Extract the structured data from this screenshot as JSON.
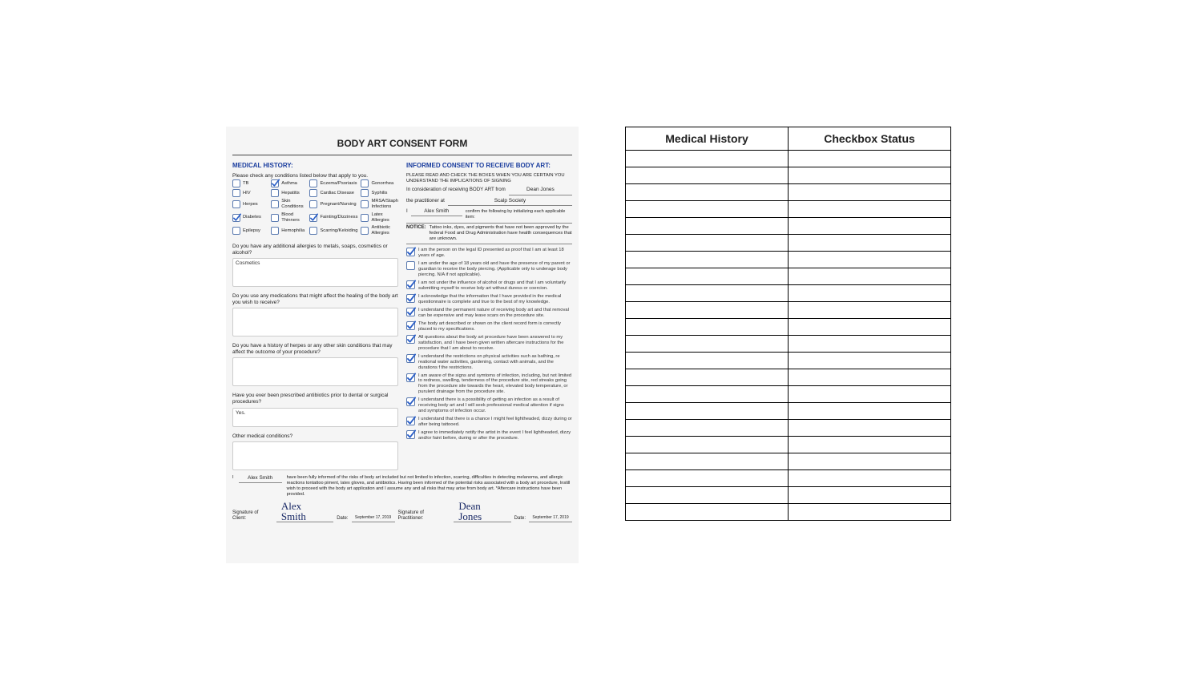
{
  "form": {
    "title": "BODY ART CONSENT FORM",
    "medical_history": {
      "heading": "MEDICAL HISTORY:",
      "instruction": "Please check any conditions listed below that apply to you.",
      "conditions": [
        {
          "label": "TB",
          "checked": false
        },
        {
          "label": "Asthma",
          "checked": true
        },
        {
          "label": "Eczema/Psoriasis",
          "checked": false
        },
        {
          "label": "Gonorrhea",
          "checked": false
        },
        {
          "label": "HIV",
          "checked": false
        },
        {
          "label": "Hepatitis",
          "checked": false
        },
        {
          "label": "Cardiac Disease",
          "checked": false
        },
        {
          "label": "Syphilis",
          "checked": false
        },
        {
          "label": "Herpes",
          "checked": false
        },
        {
          "label": "Skin Conditions",
          "checked": false
        },
        {
          "label": "Pregnant/Nursing",
          "checked": false
        },
        {
          "label": "MRSA/Staph Infections",
          "checked": false
        },
        {
          "label": "Diabetes",
          "checked": true
        },
        {
          "label": "Blood Thinners",
          "checked": false
        },
        {
          "label": "Fainting/Dizziness",
          "checked": true
        },
        {
          "label": "Latex Allergies",
          "checked": false
        },
        {
          "label": "Epilepsy",
          "checked": false
        },
        {
          "label": "Hemophilia",
          "checked": false
        },
        {
          "label": "Scarring/Keloiding",
          "checked": false
        },
        {
          "label": "Antibiotic Allergies",
          "checked": false
        }
      ],
      "q1": "Do you have any additional allergies to metals, soaps, cosmetics or alcohol?",
      "a1": "Cosmetics",
      "q2": "Do you use any medications that might affect the healing of the body art you wish to receive?",
      "a2": "",
      "q3": "Do you have a history of herpes or any other skin conditions that may affect the outcome of your procedure?",
      "a3": "",
      "q4": "Have you ever been prescribed antibiotics prior to dental or surgical procedures?",
      "a4": "Yes.",
      "q5": "Other medical conditions?",
      "a5": ""
    },
    "consent": {
      "heading": "INFORMED CONSENT TO RECEIVE BODY ART:",
      "intro": "PLEASE READ AND CHECK THE BOXES WHEN YOU ARE CERTAIN YOU UNDERSTAND THE IMPLICATIONS OF SIGNING",
      "line1_prefix": "In consideration of receiving BODY ART from",
      "from_name": "Dean Jones",
      "line2_prefix": "the practitioner at",
      "studio": "Scalp Society",
      "line3_prefix": "I",
      "client_name": "Alex Smith",
      "line3_suffix": "confirm the following by initializing each applicable item:",
      "notice_label": "NOTICE:",
      "notice_text": "Tattoo inks, dyes, and pigments that have not been approved by the federal Food and Drug Administration have health consequences that are unknown.",
      "items": [
        {
          "checked": true,
          "text": "I am the person on the legal ID presented as proof that I am at least 18 years of age."
        },
        {
          "checked": false,
          "text": "I am under the age of 18 years old and have the presence of my parent or guardian to receive the body piercing. (Applicable only to underage body piercing. N/A if not applicable)."
        },
        {
          "checked": true,
          "text": "I am not under the influence of alcohol or drugs and that I am voluntarily submitting myself to receive bdy art without duress or coercion."
        },
        {
          "checked": true,
          "text": "I acknowledge that the information that I have provided in the medical questionnaire is complete and true to the best of my knowledge."
        },
        {
          "checked": true,
          "text": "I understand the permanent nature of receiving body art and that removal can be expensive and may leave scars on the procedure site."
        },
        {
          "checked": true,
          "text": "The body art described or shown on the client record form is correctly placed to my specifications."
        },
        {
          "checked": true,
          "text": "All questions about the body art procedure have been answered to my satisfaction, and I have been given written aftercare instructions for the procedure that I am about to receive."
        },
        {
          "checked": true,
          "text": "I understand the restrictions on physical activities such as bathing, re reational water activities, gardening, contact with animals, and the durations f the restrictions."
        },
        {
          "checked": true,
          "text": "I am aware of the signs and symtoms of infection, including, but not limited to redness, swelling, tenderness of the procedure site, red streaks going from the procedure site towards the heart, elevated body temperature, or purulent drainage from the procedure site."
        },
        {
          "checked": true,
          "text": "I understand there is a possibility of getting an infection as a result of receiving body art and I will seek professional medical attention if signs and symptoms of infection occur."
        },
        {
          "checked": true,
          "text": "I understand that there is a chance I might feel lightheaded, dizzy during or after being tattooed."
        },
        {
          "checked": true,
          "text": "I agree to immediately notify the artist in the event I feel lightheaded, dizzy and/or faint before, during or after the procedure."
        }
      ]
    },
    "disclaimer_prefix": "I",
    "disclaimer_name": "Alex Smith",
    "disclaimer_text": "have been fully informed of the risks of body art included but not limited to infection, scarring, difficulties in detecting melanoma, and allergic reactions tontattoo piment, latex gloves, and antibiotics. Having been informed of the potential risks associated with a body art procedure, Instill wish to proceed with the body art application and I assume any and all risks that may arise from body art. *Aftercare instructions have been provided.",
    "sig": {
      "client_label": "Signature of Client:",
      "client_sig": "Alex Smith",
      "date_label": "Date:",
      "client_date": "September 17, 2019",
      "pract_label": "Signature of Practitioner:",
      "pract_sig": "Dean Jones",
      "pract_date": "September 17, 2019"
    }
  },
  "table": {
    "headers": [
      "Medical History",
      "Checkbox Status"
    ],
    "row_count": 22
  }
}
